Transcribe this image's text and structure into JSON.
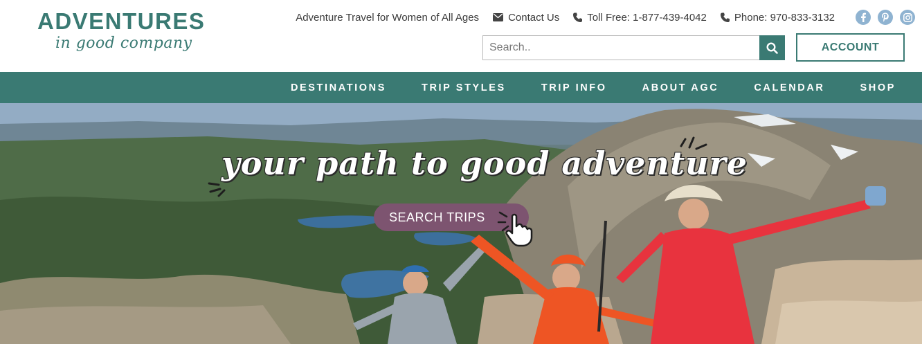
{
  "brand": {
    "logo_main": "ADVENTURES",
    "logo_sub": "in good company",
    "accent": "#3a7a73",
    "cta_color": "#7d5470"
  },
  "topbar": {
    "tagline": "Adventure Travel for Women of All Ages",
    "contact": {
      "label": "Contact Us",
      "icon": "envelope-icon"
    },
    "toll_free": {
      "label": "Toll Free: 1-877-439-4042",
      "icon": "phone-icon"
    },
    "phone": {
      "label": "Phone: 970-833-3132",
      "icon": "phone-icon"
    },
    "social": [
      "facebook-icon",
      "pinterest-icon",
      "instagram-icon"
    ]
  },
  "search": {
    "placeholder": "Search..",
    "value": "",
    "button_icon": "search-icon"
  },
  "account": {
    "label": "ACCOUNT"
  },
  "nav": {
    "items": [
      "DESTINATIONS",
      "TRIP STYLES",
      "TRIP INFO",
      "ABOUT AGC",
      "CALENDAR",
      "SHOP"
    ]
  },
  "hero": {
    "headline": "your path to good adventure",
    "cta_label": "SEARCH TRIPS",
    "cta_icon": "pointer-hand-icon"
  }
}
